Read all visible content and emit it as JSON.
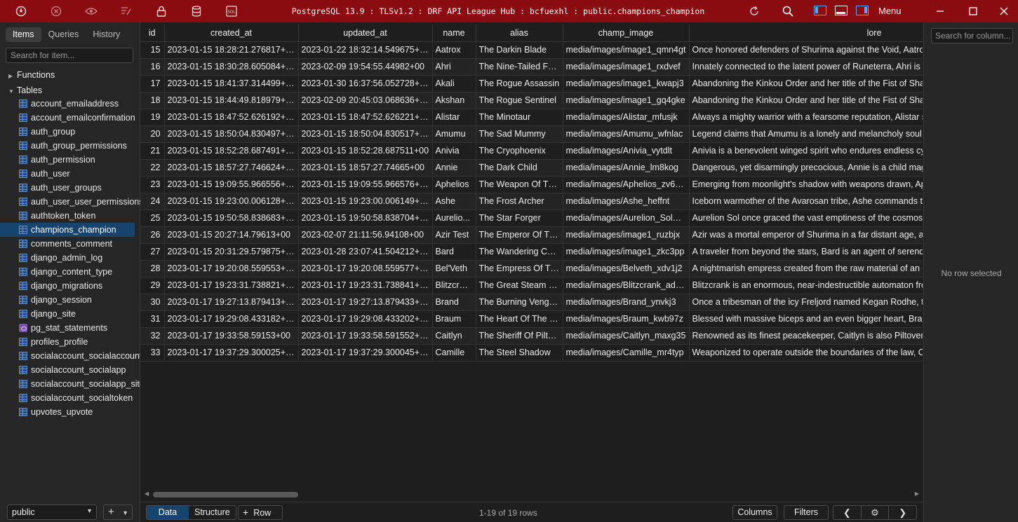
{
  "titlebar": {
    "title": "PostgreSQL 13.9 : TLSv1.2 : DRF API League Hub : bcfuexhl : public.champions_champion",
    "menu_label": "Menu"
  },
  "sidebar": {
    "tabs": [
      "Items",
      "Queries",
      "History"
    ],
    "search_placeholder": "Search for item...",
    "functions_label": "Functions",
    "tables_label": "Tables",
    "tables": [
      {
        "name": "account_emailaddress",
        "kind": "table"
      },
      {
        "name": "account_emailconfirmation",
        "kind": "table"
      },
      {
        "name": "auth_group",
        "kind": "table"
      },
      {
        "name": "auth_group_permissions",
        "kind": "table"
      },
      {
        "name": "auth_permission",
        "kind": "table"
      },
      {
        "name": "auth_user",
        "kind": "table"
      },
      {
        "name": "auth_user_groups",
        "kind": "table"
      },
      {
        "name": "auth_user_user_permissions",
        "kind": "table"
      },
      {
        "name": "authtoken_token",
        "kind": "table"
      },
      {
        "name": "champions_champion",
        "kind": "table",
        "selected": true
      },
      {
        "name": "comments_comment",
        "kind": "table"
      },
      {
        "name": "django_admin_log",
        "kind": "table"
      },
      {
        "name": "django_content_type",
        "kind": "table"
      },
      {
        "name": "django_migrations",
        "kind": "table"
      },
      {
        "name": "django_session",
        "kind": "table"
      },
      {
        "name": "django_site",
        "kind": "table"
      },
      {
        "name": "pg_stat_statements",
        "kind": "view"
      },
      {
        "name": "profiles_profile",
        "kind": "table"
      },
      {
        "name": "socialaccount_socialaccount",
        "kind": "table"
      },
      {
        "name": "socialaccount_socialapp",
        "kind": "table"
      },
      {
        "name": "socialaccount_socialapp_sites",
        "kind": "table"
      },
      {
        "name": "socialaccount_socialtoken",
        "kind": "table"
      },
      {
        "name": "upvotes_upvote",
        "kind": "table"
      }
    ],
    "schema": "public"
  },
  "grid": {
    "columns": [
      "id",
      "created_at",
      "updated_at",
      "name",
      "alias",
      "champ_image",
      "lore"
    ],
    "rows": [
      [
        "15",
        "2023-01-15 18:28:21.276817+00",
        "2023-01-22 18:32:14.549675+00",
        "Aatrox",
        "The Darkin Blade",
        "media/images/image1_qmn4gt",
        "Once honored defenders of Shurima against the Void, Aatrox a"
      ],
      [
        "16",
        "2023-01-15 18:30:28.605084+00",
        "2023-02-09 19:54:55.44982+00",
        "Ahri",
        "The Nine-Tailed Foxt",
        "media/images/image1_rxdvef",
        "Innately connected to the latent power of Runeterra, Ahri is a v"
      ],
      [
        "17",
        "2023-01-15 18:41:37.314499+00",
        "2023-01-30 16:37:56.052728+00",
        "Akali",
        "The Rogue Assassin",
        "media/images/image1_kwapj3",
        "Abandoning the Kinkou Order and her title of the Fist of Shado"
      ],
      [
        "18",
        "2023-01-15 18:44:49.818979+00",
        "2023-02-09 20:45:03.068636+00",
        "Akshan",
        "The Rogue Sentinel",
        "media/images/image1_gq4gke",
        "Abandoning the Kinkou Order and her title of the Fist of Shado"
      ],
      [
        "19",
        "2023-01-15 18:47:52.626192+00",
        "2023-01-15 18:47:52.626221+00",
        "Alistar",
        "The Minotaur",
        "media/images/Alistar_mfusjk",
        "Always a mighty warrior with a fearsome reputation, Alistar see"
      ],
      [
        "20",
        "2023-01-15 18:50:04.830497+00",
        "2023-01-15 18:50:04.830517+00",
        "Amumu",
        "The Sad Mummy",
        "media/images/Amumu_wfnlac",
        "Legend claims that Amumu is a lonely and melancholy soul fro"
      ],
      [
        "21",
        "2023-01-15 18:52:28.687491+00",
        "2023-01-15 18:52:28.687511+00",
        "Anivia",
        "The Cryophoenix",
        "media/images/Anivia_vytdlt",
        "Anivia is a benevolent winged spirit who endures endless cycle"
      ],
      [
        "22",
        "2023-01-15 18:57:27.746624+00",
        "2023-01-15 18:57:27.74665+00",
        "Annie",
        "The Dark Child",
        "media/images/Annie_lm8kog",
        "Dangerous, yet disarmingly precocious, Annie is a child mage w"
      ],
      [
        "23",
        "2023-01-15 19:09:55.966556+00",
        "2023-01-15 19:09:55.966576+00",
        "Aphelios",
        "The Weapon Of The...",
        "media/images/Aphelios_zv6ui9",
        "Emerging from moonlight's shadow with weapons drawn, Aph"
      ],
      [
        "24",
        "2023-01-15 19:23:00.006128+00",
        "2023-01-15 19:23:00.006149+00",
        "Ashe",
        "The Frost Archer",
        "media/images/Ashe_heffnt",
        "Iceborn warmother of the Avarosan tribe, Ashe commands the"
      ],
      [
        "25",
        "2023-01-15 19:50:58.838683+00",
        "2023-01-15 19:50:58.838704+00",
        "Aurelio...",
        "The Star Forger",
        "media/images/Aurelion_Sol_uj...",
        "Aurelion Sol once graced the vast emptiness of the cosmos wit"
      ],
      [
        "26",
        "2023-01-15 20:27:14.79613+00",
        "2023-02-07 21:11:56.94108+00",
        "Azir Test",
        "The Emperor Of The...",
        "media/images/image1_ruzbjx",
        "Azir was a mortal emperor of Shurima in a far distant age, a pr"
      ],
      [
        "27",
        "2023-01-15 20:31:29.579875+00",
        "2023-01-28 23:07:41.504212+00",
        "Bard",
        "The Wandering Car...",
        "media/images/image1_zkc3pp",
        "A traveler from beyond the stars, Bard is an agent of serendipi"
      ],
      [
        "28",
        "2023-01-17 19:20:08.559553+00",
        "2023-01-17 19:20:08.559577+00",
        "Bel'Veth",
        "The Empress Of The...",
        "media/images/Belveth_xdv1j2",
        "A nightmarish empress created from the raw material of an en"
      ],
      [
        "29",
        "2023-01-17 19:23:31.738821+00",
        "2023-01-17 19:23:31.738841+00",
        "Blitzcrank",
        "The Great Steam Go...",
        "media/images/Blitzcrank_adtsv7",
        "Blitzcrank is an enormous, near-indestructible automaton from"
      ],
      [
        "30",
        "2023-01-17 19:27:13.879413+00",
        "2023-01-17 19:27:13.879433+00",
        "Brand",
        "The Burning Venge...",
        "media/images/Brand_ynvkj3",
        "Once a tribesman of the icy Freljord named Kegan Rodhe, the"
      ],
      [
        "31",
        "2023-01-17 19:29:08.433182+00",
        "2023-01-17 19:29:08.433202+00",
        "Braum",
        "The Heart Of The Fr...",
        "media/images/Braum_kwb97z",
        "Blessed with massive biceps and an even bigger heart, Braum i"
      ],
      [
        "32",
        "2023-01-17 19:33:58.59153+00",
        "2023-01-17 19:33:58.591552+00",
        "Caitlyn",
        "The Sheriff Of Piltov...",
        "media/images/Caitlyn_maxg35",
        "Renowned as its finest peacekeeper, Caitlyn is also Piltover's be"
      ],
      [
        "33",
        "2023-01-17 19:37:29.300025+00",
        "2023-01-17 19:37:29.300045+00",
        "Camille",
        "The Steel Shadow",
        "media/images/Camille_mr4typ",
        "Weaponized to operate outside the boundaries of the law, Car"
      ]
    ]
  },
  "right_panel": {
    "search_placeholder": "Search for column...",
    "empty_text": "No row selected"
  },
  "footer": {
    "data_tab": "Data",
    "structure_tab": "Structure",
    "row_button": "Row",
    "count_text": "1-19 of 19 rows",
    "columns_button": "Columns",
    "filters_button": "Filters"
  },
  "colors": {
    "titlebar": "#8b0c10",
    "accent": "#16446e"
  }
}
